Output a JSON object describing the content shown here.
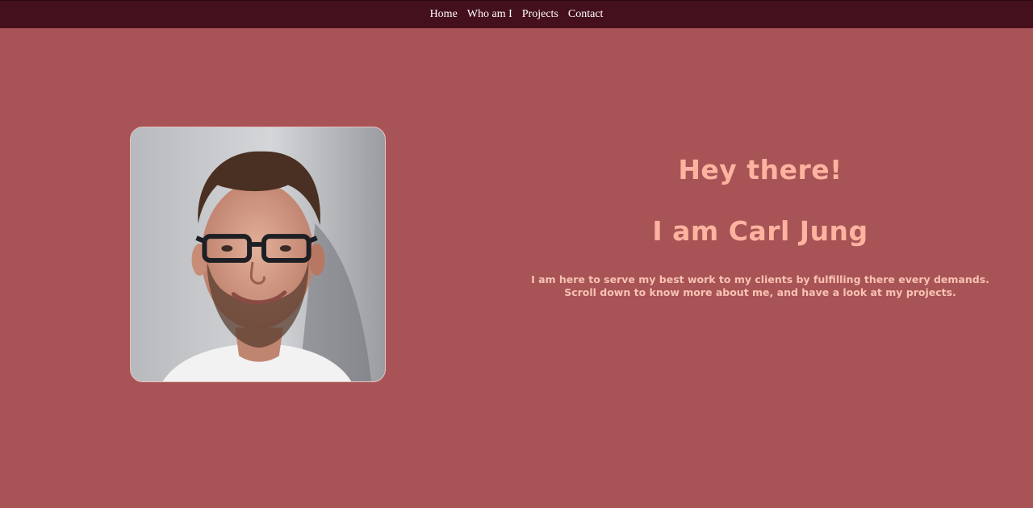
{
  "nav": {
    "items": [
      {
        "label": "Home"
      },
      {
        "label": "Who am I"
      },
      {
        "label": "Projects"
      },
      {
        "label": "Contact"
      }
    ]
  },
  "hero": {
    "greeting": "Hey there!",
    "name_heading": "I am Carl Jung",
    "intro": "I am here to serve my best work to my clients by fulfilling there every demands. Scroll down to know more about me, and have a look at my projects."
  },
  "colors": {
    "background": "#a85355",
    "navbar": "#45101d",
    "nav_text": "#ffffff",
    "heading_text": "#fdb3a0"
  }
}
